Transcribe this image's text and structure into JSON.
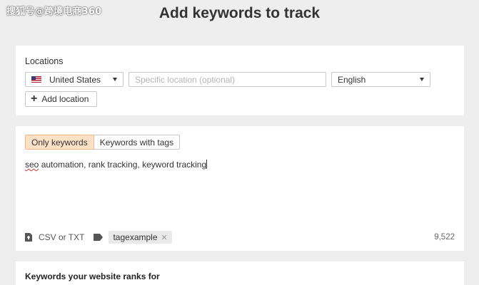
{
  "watermark": "搜狐号@跨境电商360",
  "page_title": "Add keywords to track",
  "locations": {
    "label": "Locations",
    "country": "United States",
    "country_flag": "us-flag-icon",
    "location_placeholder": "Specific location (optional)",
    "language": "English",
    "add_location_label": "Add location"
  },
  "keywords": {
    "tabs": [
      {
        "label": "Only keywords",
        "active": true
      },
      {
        "label": "Keywords with tags",
        "active": false
      }
    ],
    "text_misspelled": "seo",
    "text_rest": " automation, rank tracking, keyword tracking",
    "upload_label": "CSV or TXT",
    "tag_chip": "tagexample",
    "count": "9,522"
  },
  "ranks_section_title": "Keywords your website ranks for",
  "colors": {
    "active_tab_bg": "#fde1c6",
    "page_bg": "#eeeeee"
  }
}
